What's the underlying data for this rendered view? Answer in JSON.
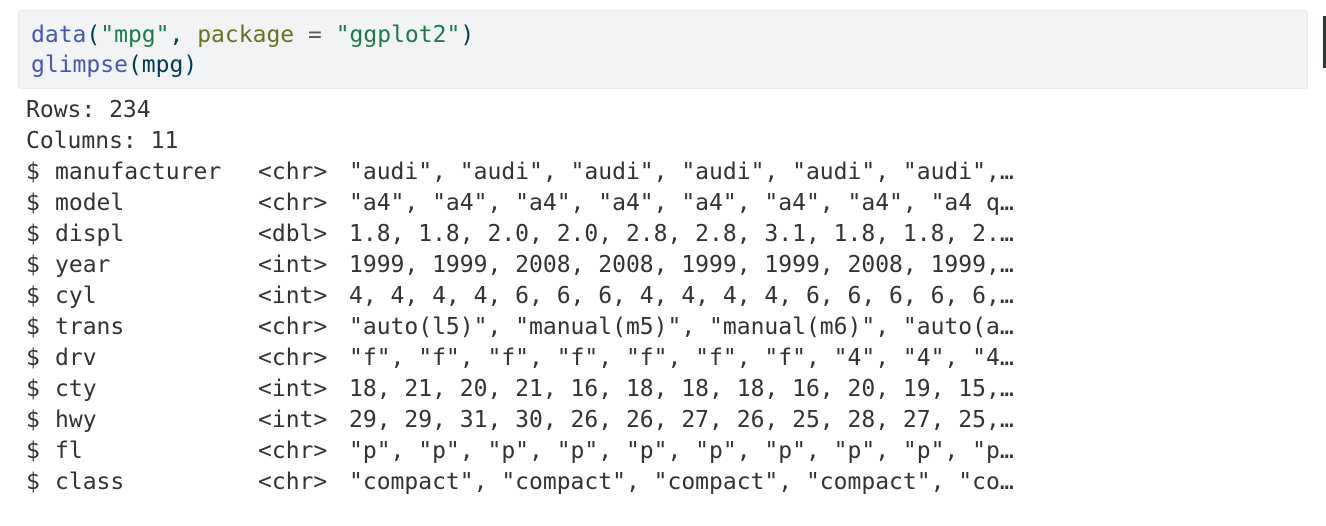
{
  "code": {
    "line1": {
      "fn": "data",
      "open": "(",
      "str1": "\"mpg\"",
      "comma": ", ",
      "arg": "package",
      "eq": " = ",
      "str2": "\"ggplot2\"",
      "close": ")"
    },
    "line2": {
      "fn": "glimpse",
      "open": "(",
      "arg": "mpg",
      "close": ")"
    }
  },
  "output": {
    "rows_line": "Rows: 234",
    "columns_line": "Columns: 11",
    "dollar": "$",
    "variables": [
      {
        "name": "manufacturer",
        "type": "<chr>",
        "values": "\"audi\", \"audi\", \"audi\", \"audi\", \"audi\", \"audi\",…"
      },
      {
        "name": "model",
        "type": "<chr>",
        "values": "\"a4\", \"a4\", \"a4\", \"a4\", \"a4\", \"a4\", \"a4\", \"a4 q…"
      },
      {
        "name": "displ",
        "type": "<dbl>",
        "values": "1.8, 1.8, 2.0, 2.0, 2.8, 2.8, 3.1, 1.8, 1.8, 2.…"
      },
      {
        "name": "year",
        "type": "<int>",
        "values": "1999, 1999, 2008, 2008, 1999, 1999, 2008, 1999,…"
      },
      {
        "name": "cyl",
        "type": "<int>",
        "values": "4, 4, 4, 4, 6, 6, 6, 4, 4, 4, 4, 6, 6, 6, 6, 6,…"
      },
      {
        "name": "trans",
        "type": "<chr>",
        "values": "\"auto(l5)\", \"manual(m5)\", \"manual(m6)\", \"auto(a…"
      },
      {
        "name": "drv",
        "type": "<chr>",
        "values": "\"f\", \"f\", \"f\", \"f\", \"f\", \"f\", \"f\", \"4\", \"4\", \"4…"
      },
      {
        "name": "cty",
        "type": "<int>",
        "values": "18, 21, 20, 21, 16, 18, 18, 18, 16, 20, 19, 15,…"
      },
      {
        "name": "hwy",
        "type": "<int>",
        "values": "29, 29, 31, 30, 26, 26, 27, 26, 25, 28, 27, 25,…"
      },
      {
        "name": "fl",
        "type": "<chr>",
        "values": "\"p\", \"p\", \"p\", \"p\", \"p\", \"p\", \"p\", \"p\", \"p\", \"p…"
      },
      {
        "name": "class",
        "type": "<chr>",
        "values": "\"compact\", \"compact\", \"compact\", \"compact\", \"co…"
      }
    ]
  }
}
